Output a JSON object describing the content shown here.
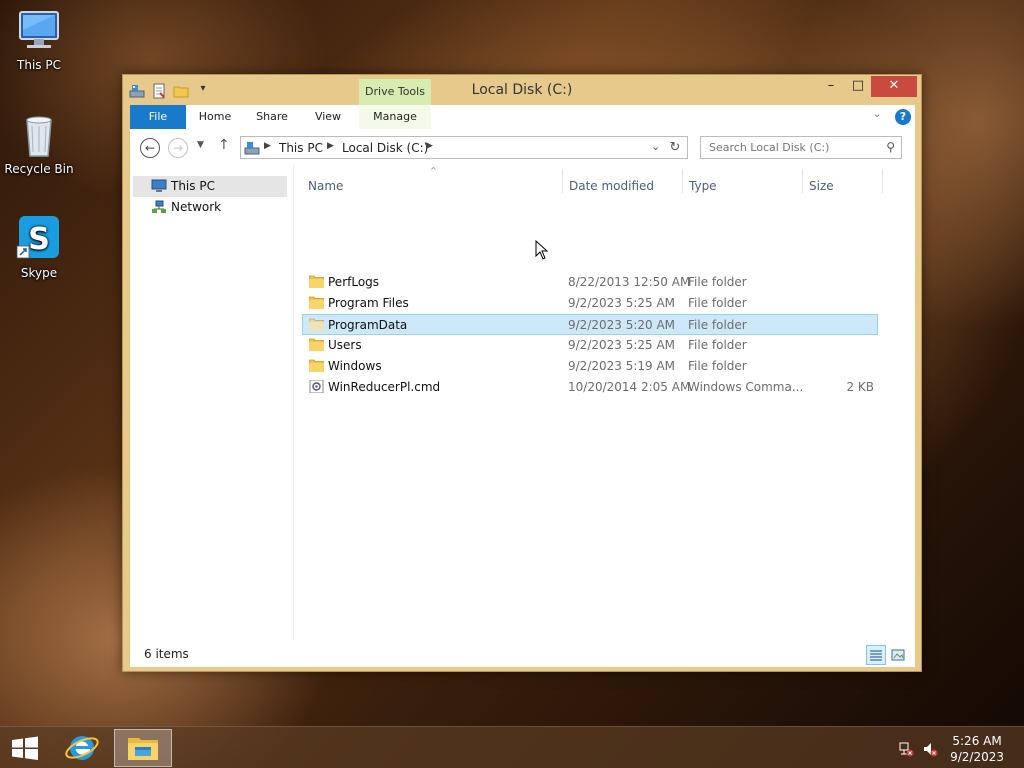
{
  "desktop": {
    "icons": [
      {
        "label": "This PC",
        "icon": "computer-icon"
      },
      {
        "label": "Recycle Bin",
        "icon": "recycle-bin-icon"
      },
      {
        "label": "Skype",
        "icon": "skype-icon"
      }
    ]
  },
  "window": {
    "title": "Local Disk (C:)",
    "contextual_tab_group": "Drive Tools",
    "ribbon_tabs": [
      "File",
      "Home",
      "Share",
      "View",
      "Manage"
    ],
    "controls": {
      "minimize": "–",
      "maximize": "□",
      "close": "✕"
    },
    "breadcrumb": [
      "This PC",
      "Local Disk (C:)"
    ],
    "search_placeholder": "Search Local Disk (C:)",
    "nav_pane": [
      {
        "label": "This PC",
        "icon": "computer-icon",
        "selected": true
      },
      {
        "label": "Network",
        "icon": "network-icon",
        "selected": false
      }
    ],
    "columns": [
      "Name",
      "Date modified",
      "Type",
      "Size"
    ],
    "files": [
      {
        "name": "PerfLogs",
        "date": "8/22/2013 12:50 AM",
        "type": "File folder",
        "size": "",
        "icon": "folder-icon",
        "selected": false
      },
      {
        "name": "Program Files",
        "date": "9/2/2023 5:25 AM",
        "type": "File folder",
        "size": "",
        "icon": "folder-icon",
        "selected": false
      },
      {
        "name": "ProgramData",
        "date": "9/2/2023 5:20 AM",
        "type": "File folder",
        "size": "",
        "icon": "folder-icon",
        "selected": true
      },
      {
        "name": "Users",
        "date": "9/2/2023 5:25 AM",
        "type": "File folder",
        "size": "",
        "icon": "folder-icon",
        "selected": false
      },
      {
        "name": "Windows",
        "date": "9/2/2023 5:19 AM",
        "type": "File folder",
        "size": "",
        "icon": "folder-icon",
        "selected": false
      },
      {
        "name": "WinReducerPl.cmd",
        "date": "10/20/2014 2:05 AM",
        "type": "Windows Comma...",
        "size": "2 KB",
        "icon": "cmd-file-icon",
        "selected": false
      }
    ],
    "status": "6 items"
  },
  "taskbar": {
    "time": "5:26 AM",
    "date": "9/2/2023"
  },
  "colors": {
    "accent": "#1979ca",
    "selection_bg": "#cde8f9",
    "selection_border": "#99d1f5",
    "close_button": "#c94a3f",
    "window_frame": "#e8c98c",
    "contextual_tab": "#d8ecb0"
  }
}
